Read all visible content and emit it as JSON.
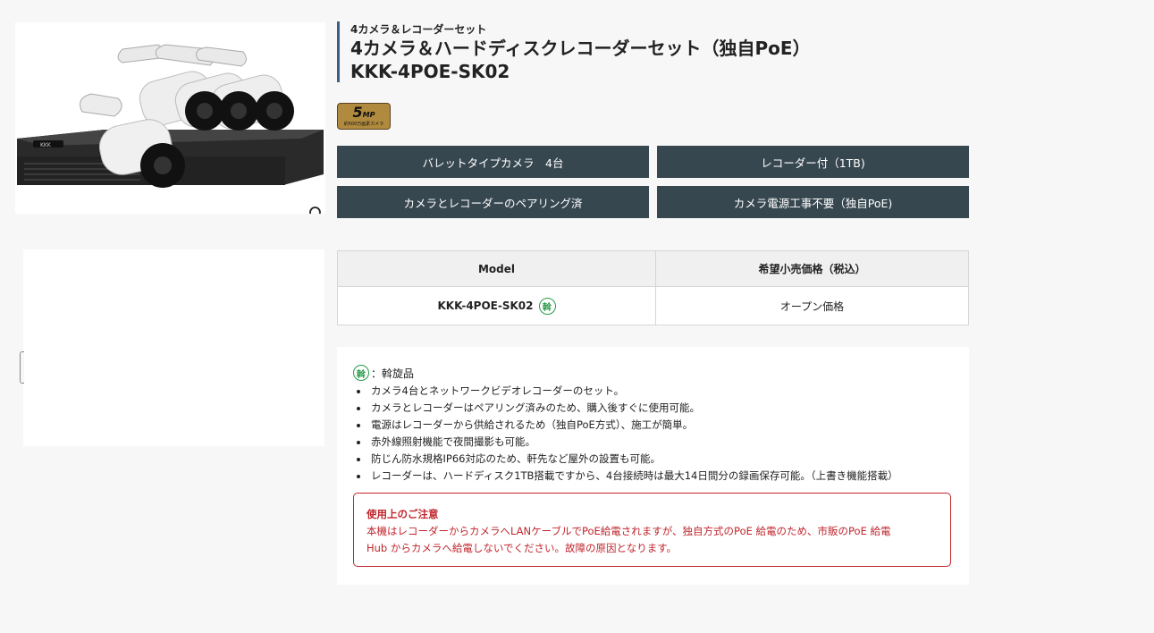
{
  "product": {
    "subtitle": "4カメラ＆レコーダーセット",
    "title_line1": "4カメラ＆ハードディスクレコーダーセット（独自PoE）",
    "title_line2": "KKK-4POE-SK02",
    "badge_main": "5",
    "badge_unit": "MP",
    "badge_caption": "約500万画素カメラ"
  },
  "features": [
    "バレットタイプカメラ　4台",
    "レコーダー付（1TB)",
    "カメラとレコーダーのペアリング済",
    "カメラ電源工事不要（独自PoE)"
  ],
  "table": {
    "headers": [
      "Model",
      "希望小売価格（税込）"
    ],
    "model": "KKK-4POE-SK02",
    "price": "オープン価格",
    "badge_char": "斡"
  },
  "description": {
    "legend_char": "斡",
    "legend_text": "：斡旋品",
    "bullets": [
      "カメラ4台とネットワークビデオレコーダーのセット。",
      "カメラとレコーダーはペアリング済みのため、購入後すぐに使用可能。",
      "電源はレコーダーから供給されるため（独自PoE方式）、施工が簡単。",
      "赤外線照射機能で夜間撮影も可能。",
      "防じん防水規格IP66対応のため、軒先など屋外の設置も可能。",
      "レコーダーは、ハードディスク1TB搭載ですから、4台接続時は最大14日間分の録画保存可能。（上書き機能搭載）"
    ],
    "caution_title": "使用上のご注意",
    "caution_line1": "本機はレコーダーからカメラへLANケーブルでPoE給電されますが、独自方式のPoE 給電のため、市販のPoE 給電",
    "caution_line2": "Hub からカメラへ給電しないでください。故障の原因となります。"
  },
  "recorder_logo": "KKK",
  "colors": {
    "feature_bg": "#374750",
    "title_border": "#3a5f86",
    "caution": "#c0262d",
    "badge_green": "#2a9b4a"
  }
}
